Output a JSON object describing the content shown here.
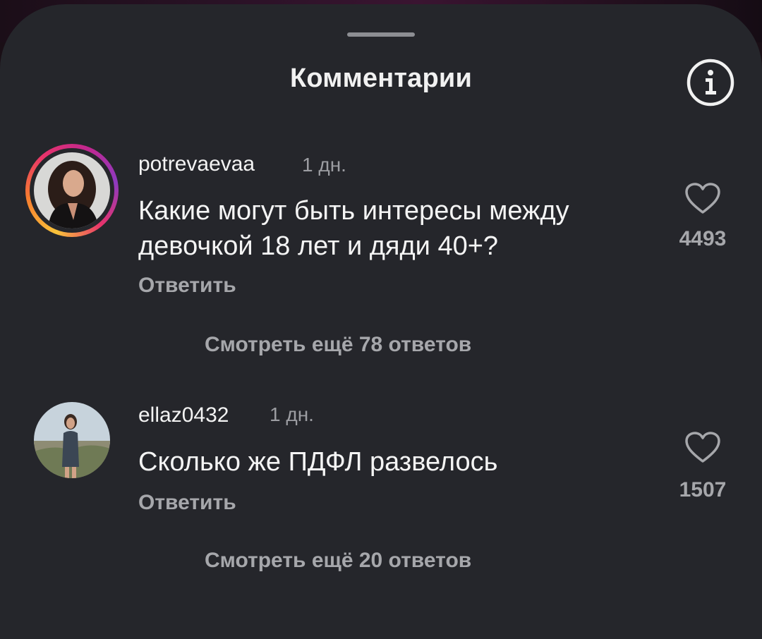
{
  "header": {
    "title": "Комментарии",
    "info_icon": "info-circle-icon"
  },
  "comments": [
    {
      "username": "potrevaevaa",
      "time": "1 дн.",
      "text": "Какие могут быть интересы между девочкой 18 лет и дяди 40+?",
      "reply_label": "Ответить",
      "likes": "4493",
      "view_more": "Смотреть ещё 78 ответов",
      "has_story_ring": true
    },
    {
      "username": "ellaz0432",
      "time": "1 дн.",
      "text": "Сколько же ПДФЛ развелось",
      "reply_label": "Ответить",
      "likes": "1507",
      "view_more": "Смотреть ещё 20 ответов",
      "has_story_ring": false
    }
  ],
  "colors": {
    "sheet_background": "#25262b",
    "primary_text": "#f4f4f4",
    "secondary_text": "#a6a7ab"
  }
}
